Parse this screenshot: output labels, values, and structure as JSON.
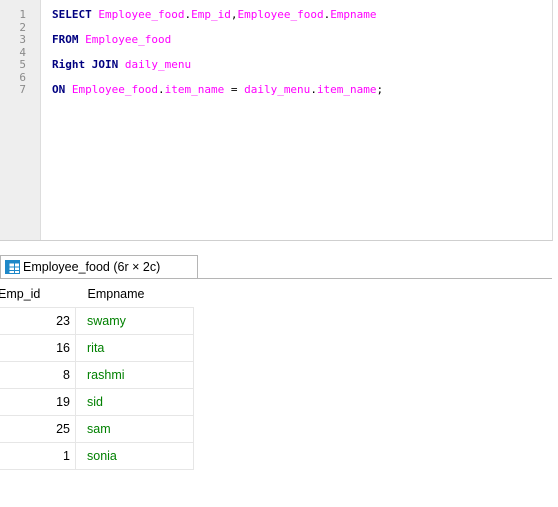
{
  "editor": {
    "line_numbers": [
      "1",
      "2",
      "3",
      "4",
      "5",
      "6",
      "7"
    ],
    "lines": [
      [
        {
          "t": "SELECT",
          "c": "kw"
        },
        {
          "t": " ",
          "c": "tx"
        },
        {
          "t": "Employee_food",
          "c": "id"
        },
        {
          "t": ".",
          "c": "tx"
        },
        {
          "t": "Emp_id",
          "c": "id"
        },
        {
          "t": ",",
          "c": "tx"
        },
        {
          "t": "Employee_food",
          "c": "id"
        },
        {
          "t": ".",
          "c": "tx"
        },
        {
          "t": "Empname",
          "c": "id"
        }
      ],
      [],
      [
        {
          "t": "FROM",
          "c": "kw"
        },
        {
          "t": " ",
          "c": "tx"
        },
        {
          "t": "Employee_food",
          "c": "id"
        }
      ],
      [],
      [
        {
          "t": "Right JOIN",
          "c": "kw"
        },
        {
          "t": " ",
          "c": "tx"
        },
        {
          "t": "daily_menu",
          "c": "id"
        }
      ],
      [],
      [
        {
          "t": "ON",
          "c": "kw"
        },
        {
          "t": " ",
          "c": "tx"
        },
        {
          "t": "Employee_food",
          "c": "id"
        },
        {
          "t": ".",
          "c": "tx"
        },
        {
          "t": "item_name",
          "c": "id"
        },
        {
          "t": " = ",
          "c": "tx"
        },
        {
          "t": "daily_menu",
          "c": "id"
        },
        {
          "t": ".",
          "c": "tx"
        },
        {
          "t": "item_name",
          "c": "id"
        },
        {
          "t": ";",
          "c": "tx"
        }
      ]
    ]
  },
  "result_tab": {
    "label": "Employee_food (6r × 2c)",
    "icon": "table-grid-icon"
  },
  "grid": {
    "columns": [
      "Emp_id",
      "Empname"
    ],
    "rows": [
      {
        "emp_id": "23",
        "empname": "swamy"
      },
      {
        "emp_id": "16",
        "empname": "rita"
      },
      {
        "emp_id": "8",
        "empname": "rashmi"
      },
      {
        "emp_id": "19",
        "empname": "sid"
      },
      {
        "emp_id": "25",
        "empname": "sam"
      },
      {
        "emp_id": "1",
        "empname": "sonia"
      }
    ]
  },
  "colors": {
    "keyword": "#000080",
    "identifier": "#ff00ff",
    "name_cell": "#008000"
  }
}
